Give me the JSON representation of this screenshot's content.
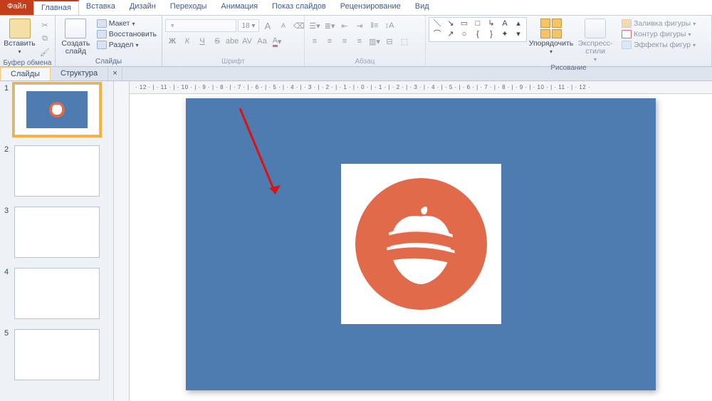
{
  "tabs": {
    "file": "Файл",
    "items": [
      "Главная",
      "Вставка",
      "Дизайн",
      "Переходы",
      "Анимация",
      "Показ слайдов",
      "Рецензирование",
      "Вид"
    ],
    "active_index": 0
  },
  "ribbon": {
    "clipboard": {
      "paste": "Вставить",
      "title": "Буфер обмена"
    },
    "slides": {
      "new_slide": "Создать\nслайд",
      "layout": "Макет",
      "restore": "Восстановить",
      "section": "Раздел",
      "title": "Слайды"
    },
    "font": {
      "name_placeholder": "",
      "size": "18",
      "grow": "A",
      "shrink": "A",
      "title": "Шрифт",
      "b": "Ж",
      "i": "К",
      "u": "Ч",
      "s": "S",
      "shadow": "abe",
      "spacing": "AV",
      "case": "Aa"
    },
    "paragraph": {
      "title": "Абзац"
    },
    "drawing": {
      "arrange": "Упорядочить",
      "quick_styles": "Экспресс-стили",
      "fill": "Заливка фигуры",
      "outline": "Контур фигуры",
      "effects": "Эффекты фигур",
      "title": "Рисование"
    }
  },
  "panel_tabs": {
    "slides": "Слайды",
    "outline": "Структура",
    "close": "×"
  },
  "thumbnails": [
    {
      "num": "1",
      "has_content": true,
      "selected": true
    },
    {
      "num": "2",
      "has_content": false,
      "selected": false
    },
    {
      "num": "3",
      "has_content": false,
      "selected": false
    },
    {
      "num": "4",
      "has_content": false,
      "selected": false
    },
    {
      "num": "5",
      "has_content": false,
      "selected": false
    }
  ],
  "ruler_h": "· 12 · | · 11 · | · 10 · | · 9 · | · 8 · | · 7 · | · 6 · | · 5 · | · 4 · | · 3 · | · 2 · | · 1 · | · 0 · | · 1 · | · 2 · | · 3 · | · 4 · | · 5 · | · 6 · | · 7 · | · 8 · | · 9 · | · 10 · | · 11 · | · 12 ·",
  "colors": {
    "slide_bg": "#4e7cb0",
    "logo": "#e06a49",
    "accent": "#c43e1c"
  }
}
